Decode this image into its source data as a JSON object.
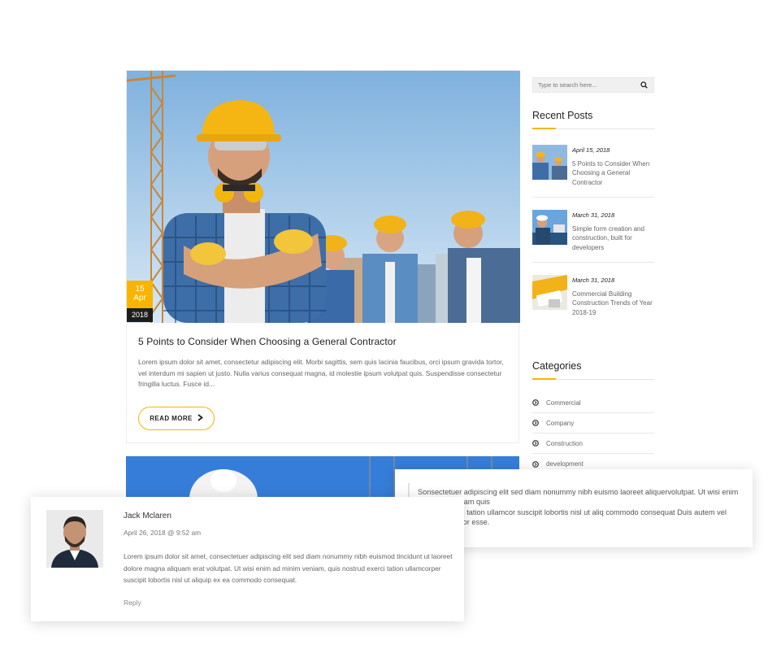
{
  "post": {
    "date_day": "15",
    "date_month": "Apr",
    "date_year": "2018",
    "title": "5 Points to Consider When Choosing a General Contractor",
    "excerpt": "Lorem ipsum dolor sit amet, consectetur adipiscing elit. Morbi sagittis, sem quis lacinia faucibus, orci ipsum gravida tortor, vel interdum mi sapien ut justo. Nulla varius consequat magna, id molestie ipsum volutpat quis. Suspendisse consectetur fringilla luctus. Fusce id...",
    "read_more_label": "READ MORE",
    "read_more_icon": "chevron-right-icon"
  },
  "search": {
    "placeholder": "Type to search here...",
    "icon": "search-icon"
  },
  "recent_posts": {
    "title": "Recent Posts",
    "items": [
      {
        "date": "April 15, 2018",
        "title": "5 Points to Consider When Choosing a General Contractor"
      },
      {
        "date": "March 31, 2018",
        "title": "Simple form creation and construction, built for developers"
      },
      {
        "date": "March 31, 2018",
        "title": "Commercial Building Construction Trends of Year 2018-19"
      }
    ]
  },
  "categories": {
    "title": "Categories",
    "icon": "arrow-circle-right-icon",
    "items": [
      "Commercial",
      "Company",
      "Construction",
      "development"
    ]
  },
  "quote": {
    "line1": "Sonsectetuer adipiscing elit sed diam nonummy nibh euismo laoreet aliquervolutpat. Ut wisi enim",
    "line2": "ad minim veniam quis",
    "line3": "nostrud exerci tation ullamcor suscipit lobortis nisl ut aliq commodo consequat Duis autem vel",
    "line4": "eum iriure dolor esse."
  },
  "comment": {
    "author": "Jack Mclaren",
    "date": "April 26, 2018 @ 9:52 am",
    "text": "Lorem ipsum dolor sit amet, consectetuer adipiscing elit sed diam nonummy nibh euismod tincidunt ut laoreet dolore magna aliquam erat volutpat. Ut wisi enim ad minim veniam, quis nostrud exerci tation ullamcorper suscipit lobortis nisl ut aliquip ex ea commodo consequat.",
    "reply_label": "Reply"
  },
  "colors": {
    "accent": "#f7b500",
    "dark": "#1d1d1d",
    "text": "#666666"
  }
}
